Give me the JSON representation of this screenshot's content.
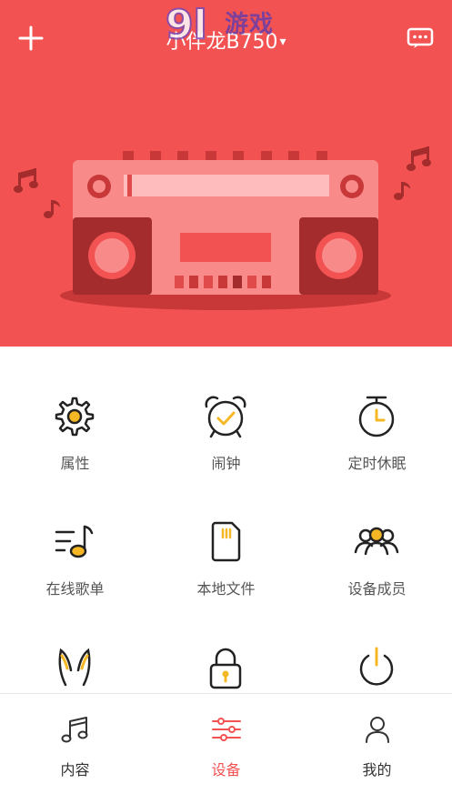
{
  "header": {
    "device_name": "小伴龙B750",
    "caret": "▾",
    "watermark": "游戏"
  },
  "grid": [
    {
      "label": "属性",
      "icon": "gear-icon"
    },
    {
      "label": "闹钟",
      "icon": "alarm-clock-icon"
    },
    {
      "label": "定时休眠",
      "icon": "timer-icon"
    },
    {
      "label": "在线歌单",
      "icon": "playlist-icon"
    },
    {
      "label": "本地文件",
      "icon": "sd-card-icon"
    },
    {
      "label": "设备成员",
      "icon": "members-icon"
    },
    {
      "label": "",
      "icon": "rabbit-ears-icon"
    },
    {
      "label": "",
      "icon": "lock-icon"
    },
    {
      "label": "",
      "icon": "power-icon"
    }
  ],
  "tabs": [
    {
      "label": "内容",
      "icon": "music-note-icon",
      "active": false
    },
    {
      "label": "设备",
      "icon": "sliders-icon",
      "active": true
    },
    {
      "label": "我的",
      "icon": "user-icon",
      "active": false
    }
  ],
  "colors": {
    "accent": "#f25252",
    "icon_yellow": "#f5b824",
    "icon_dark": "#222222"
  }
}
